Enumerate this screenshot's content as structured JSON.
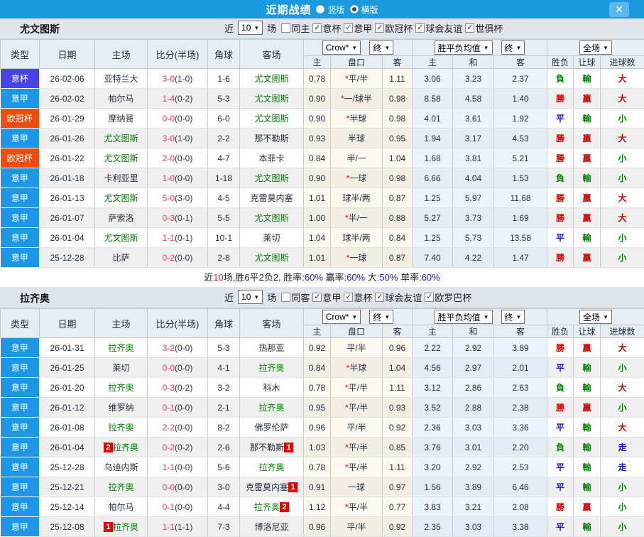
{
  "titlebar": {
    "title": "近期战绩",
    "radios": [
      {
        "label": "竖版",
        "selected": false
      },
      {
        "label": "横版",
        "selected": true
      }
    ],
    "close_label": "✕"
  },
  "colors": {
    "topbar": "#1b99de",
    "team_green": "#008000",
    "score_red": "#f53d55",
    "type_badges": {
      "意杯": "#4a42e4",
      "意甲": "#1d96e8",
      "欧冠杯": "#f04a0e"
    }
  },
  "table_header": {
    "cols": [
      "类型",
      "日期",
      "主场",
      "比分(半场)",
      "角球",
      "客场"
    ],
    "subcols": [
      "主",
      "盘口",
      "客",
      "主",
      "和",
      "客",
      "胜负",
      "让球",
      "进球数"
    ],
    "dropdowns": {
      "crow": "Crow*",
      "end1": "终",
      "avg": "胜平负均值",
      "end2": "终",
      "full": "全场"
    }
  },
  "sections": [
    {
      "team": "尤文图斯",
      "filter": {
        "prefix": "近",
        "count": "10",
        "suffix": "场",
        "checkboxes": [
          {
            "label": "同主",
            "checked": false
          },
          {
            "label": "意杯",
            "checked": true
          },
          {
            "label": "意甲",
            "checked": true
          },
          {
            "label": "欧冠杯",
            "checked": true
          },
          {
            "label": "球会友谊",
            "checked": true
          },
          {
            "label": "世俱杯",
            "checked": true
          }
        ]
      },
      "rows": [
        {
          "type": "意杯",
          "date": "26-02-06",
          "home": "亚特兰大",
          "home_focal": false,
          "home_card": "",
          "ft": "3-0",
          "ht": "(1-0)",
          "corner": "1-6",
          "away": "尤文图斯",
          "away_focal": true,
          "away_card": "",
          "ah_home": "0.78",
          "ah_line": "*平/半",
          "ah_away": "1.11",
          "o_home": "3.06",
          "o_draw": "3.23",
          "o_away": "2.37",
          "r_wdl": "負",
          "r_ah": "輸",
          "r_ou": "大"
        },
        {
          "type": "意甲",
          "date": "26-02-02",
          "home": "帕尔马",
          "home_focal": false,
          "home_card": "",
          "ft": "1-4",
          "ht": "(0-2)",
          "corner": "5-3",
          "away": "尤文图斯",
          "away_focal": true,
          "away_card": "",
          "ah_home": "0.90",
          "ah_line": "*一/球半",
          "ah_away": "0.98",
          "o_home": "8.58",
          "o_draw": "4.58",
          "o_away": "1.40",
          "r_wdl": "勝",
          "r_ah": "贏",
          "r_ou": "大"
        },
        {
          "type": "欧冠杯",
          "date": "26-01-29",
          "home": "摩纳哥",
          "home_focal": false,
          "home_card": "",
          "ft": "0-0",
          "ht": "(0-0)",
          "corner": "6-0",
          "away": "尤文图斯",
          "away_focal": true,
          "away_card": "",
          "ah_home": "0.90",
          "ah_line": "*半球",
          "ah_away": "0.98",
          "o_home": "4.01",
          "o_draw": "3.61",
          "o_away": "1.92",
          "r_wdl": "平",
          "r_ah": "輸",
          "r_ou": "小"
        },
        {
          "type": "意甲",
          "date": "26-01-26",
          "home": "尤文图斯",
          "home_focal": true,
          "home_card": "",
          "ft": "3-0",
          "ht": "(1-0)",
          "corner": "2-2",
          "away": "那不勒斯",
          "away_focal": false,
          "away_card": "",
          "ah_home": "0.93",
          "ah_line": "半球",
          "ah_away": "0.95",
          "o_home": "1.94",
          "o_draw": "3.17",
          "o_away": "4.53",
          "r_wdl": "勝",
          "r_ah": "贏",
          "r_ou": "大"
        },
        {
          "type": "欧冠杯",
          "date": "26-01-22",
          "home": "尤文图斯",
          "home_focal": true,
          "home_card": "",
          "ft": "2-0",
          "ht": "(0-0)",
          "corner": "4-7",
          "away": "本菲卡",
          "away_focal": false,
          "away_card": "",
          "ah_home": "0.84",
          "ah_line": "半/一",
          "ah_away": "1.04",
          "o_home": "1.68",
          "o_draw": "3.81",
          "o_away": "5.21",
          "r_wdl": "勝",
          "r_ah": "贏",
          "r_ou": "小"
        },
        {
          "type": "意甲",
          "date": "26-01-18",
          "home": "卡利亚里",
          "home_focal": false,
          "home_card": "",
          "ft": "1-0",
          "ht": "(0-0)",
          "corner": "1-18",
          "away": "尤文图斯",
          "away_focal": true,
          "away_card": "",
          "ah_home": "0.90",
          "ah_line": "*一球",
          "ah_away": "0.98",
          "o_home": "6.66",
          "o_draw": "4.04",
          "o_away": "1.53",
          "r_wdl": "負",
          "r_ah": "輸",
          "r_ou": "小"
        },
        {
          "type": "意甲",
          "date": "26-01-13",
          "home": "尤文图斯",
          "home_focal": true,
          "home_card": "",
          "ft": "5-0",
          "ht": "(3-0)",
          "corner": "4-5",
          "away": "克雷莫内塞",
          "away_focal": false,
          "away_card": "",
          "ah_home": "1.01",
          "ah_line": "球半/两",
          "ah_away": "0.87",
          "o_home": "1.25",
          "o_draw": "5.97",
          "o_away": "11.68",
          "r_wdl": "勝",
          "r_ah": "贏",
          "r_ou": "大"
        },
        {
          "type": "意甲",
          "date": "26-01-07",
          "home": "萨索洛",
          "home_focal": false,
          "home_card": "",
          "ft": "0-3",
          "ht": "(0-1)",
          "corner": "5-5",
          "away": "尤文图斯",
          "away_focal": true,
          "away_card": "",
          "ah_home": "1.00",
          "ah_line": "*半/一",
          "ah_away": "0.88",
          "o_home": "5.27",
          "o_draw": "3.73",
          "o_away": "1.69",
          "r_wdl": "勝",
          "r_ah": "贏",
          "r_ou": "大"
        },
        {
          "type": "意甲",
          "date": "26-01-04",
          "home": "尤文图斯",
          "home_focal": true,
          "home_card": "",
          "ft": "1-1",
          "ht": "(0-1)",
          "corner": "10-1",
          "away": "莱切",
          "away_focal": false,
          "away_card": "",
          "ah_home": "1.04",
          "ah_line": "球半/两",
          "ah_away": "0.84",
          "o_home": "1.25",
          "o_draw": "5.73",
          "o_away": "13.58",
          "r_wdl": "平",
          "r_ah": "輸",
          "r_ou": "小"
        },
        {
          "type": "意甲",
          "date": "25-12-28",
          "home": "比萨",
          "home_focal": false,
          "home_card": "",
          "ft": "0-2",
          "ht": "(0-0)",
          "corner": "2-8",
          "away": "尤文图斯",
          "away_focal": true,
          "away_card": "",
          "ah_home": "1.01",
          "ah_line": "*一球",
          "ah_away": "0.87",
          "o_home": "7.40",
          "o_draw": "4.22",
          "o_away": "1.47",
          "r_wdl": "勝",
          "r_ah": "贏",
          "r_ou": "小"
        }
      ],
      "summary": [
        [
          "近",
          "k"
        ],
        [
          "10",
          "r"
        ],
        [
          "场,胜6平2负2, 胜率:",
          "k"
        ],
        [
          "60%",
          "b"
        ],
        [
          " 赢率:",
          "k"
        ],
        [
          "60%",
          "b"
        ],
        [
          " 大:",
          "k"
        ],
        [
          "50%",
          "b"
        ],
        [
          " 单率:",
          "k"
        ],
        [
          "60%",
          "b"
        ]
      ]
    },
    {
      "team": "拉齐奥",
      "filter": {
        "prefix": "近",
        "count": "10",
        "suffix": "场",
        "checkboxes": [
          {
            "label": "同客",
            "checked": false
          },
          {
            "label": "意甲",
            "checked": true
          },
          {
            "label": "意杯",
            "checked": true
          },
          {
            "label": "球会友谊",
            "checked": true
          },
          {
            "label": "欧罗巴杯",
            "checked": true
          }
        ]
      },
      "rows": [
        {
          "type": "意甲",
          "date": "26-01-31",
          "home": "拉齐奥",
          "home_focal": true,
          "home_card": "",
          "ft": "3-2",
          "ht": "(0-0)",
          "corner": "5-3",
          "away": "热那亚",
          "away_focal": false,
          "away_card": "",
          "ah_home": "0.92",
          "ah_line": "平/半",
          "ah_away": "0.96",
          "o_home": "2.22",
          "o_draw": "2.92",
          "o_away": "3.89",
          "r_wdl": "勝",
          "r_ah": "贏",
          "r_ou": "大"
        },
        {
          "type": "意甲",
          "date": "26-01-25",
          "home": "莱切",
          "home_focal": false,
          "home_card": "",
          "ft": "0-0",
          "ht": "(0-0)",
          "corner": "4-1",
          "away": "拉齐奥",
          "away_focal": true,
          "away_card": "",
          "ah_home": "0.84",
          "ah_line": "*半球",
          "ah_away": "1.04",
          "o_home": "4.56",
          "o_draw": "2.97",
          "o_away": "2.01",
          "r_wdl": "平",
          "r_ah": "輸",
          "r_ou": "小"
        },
        {
          "type": "意甲",
          "date": "26-01-20",
          "home": "拉齐奥",
          "home_focal": true,
          "home_card": "",
          "ft": "0-3",
          "ht": "(0-2)",
          "corner": "3-2",
          "away": "科木",
          "away_focal": false,
          "away_card": "",
          "ah_home": "0.78",
          "ah_line": "*平/半",
          "ah_away": "1.11",
          "o_home": "3.12",
          "o_draw": "2.86",
          "o_away": "2.63",
          "r_wdl": "負",
          "r_ah": "輸",
          "r_ou": "大"
        },
        {
          "type": "意甲",
          "date": "26-01-12",
          "home": "维罗纳",
          "home_focal": false,
          "home_card": "",
          "ft": "0-1",
          "ht": "(0-0)",
          "corner": "2-1",
          "away": "拉齐奥",
          "away_focal": true,
          "away_card": "",
          "ah_home": "0.95",
          "ah_line": "*平/半",
          "ah_away": "0.93",
          "o_home": "3.52",
          "o_draw": "2.88",
          "o_away": "2.38",
          "r_wdl": "勝",
          "r_ah": "贏",
          "r_ou": "小"
        },
        {
          "type": "意甲",
          "date": "26-01-08",
          "home": "拉齐奥",
          "home_focal": true,
          "home_card": "",
          "ft": "2-2",
          "ht": "(0-0)",
          "corner": "8-2",
          "away": "佛罗伦萨",
          "away_focal": false,
          "away_card": "",
          "ah_home": "0.96",
          "ah_line": "平/半",
          "ah_away": "0.92",
          "o_home": "2.36",
          "o_draw": "3.03",
          "o_away": "3.36",
          "r_wdl": "平",
          "r_ah": "輸",
          "r_ou": "大"
        },
        {
          "type": "意甲",
          "date": "26-01-04",
          "home": "拉齐奥",
          "home_focal": true,
          "home_card": "2",
          "ft": "0-2",
          "ht": "(0-2)",
          "corner": "2-6",
          "away": "那不勒斯",
          "away_focal": false,
          "away_card": "1",
          "ah_home": "1.03",
          "ah_line": "*平/半",
          "ah_away": "0.85",
          "o_home": "3.76",
          "o_draw": "3.01",
          "o_away": "2.20",
          "r_wdl": "負",
          "r_ah": "輸",
          "r_ou": "走"
        },
        {
          "type": "意甲",
          "date": "25-12-28",
          "home": "乌迪内斯",
          "home_focal": false,
          "home_card": "",
          "ft": "1-1",
          "ht": "(0-0)",
          "corner": "5-6",
          "away": "拉齐奥",
          "away_focal": true,
          "away_card": "",
          "ah_home": "0.78",
          "ah_line": "*平/半",
          "ah_away": "1.11",
          "o_home": "3.20",
          "o_draw": "2.92",
          "o_away": "2.53",
          "r_wdl": "平",
          "r_ah": "輸",
          "r_ou": "走"
        },
        {
          "type": "意甲",
          "date": "25-12-21",
          "home": "拉齐奥",
          "home_focal": true,
          "home_card": "",
          "ft": "0-0",
          "ht": "(0-0)",
          "corner": "3-0",
          "away": "克雷莫内塞",
          "away_focal": false,
          "away_card": "1",
          "ah_home": "0.91",
          "ah_line": "一球",
          "ah_away": "0.97",
          "o_home": "1.56",
          "o_draw": "3.89",
          "o_away": "6.46",
          "r_wdl": "平",
          "r_ah": "輸",
          "r_ou": "小"
        },
        {
          "type": "意甲",
          "date": "25-12-14",
          "home": "帕尔马",
          "home_focal": false,
          "home_card": "",
          "ft": "0-1",
          "ht": "(0-0)",
          "corner": "4-4",
          "away": "拉齐奥",
          "away_focal": true,
          "away_card": "2",
          "ah_home": "1.12",
          "ah_line": "*平/半",
          "ah_away": "0.77",
          "o_home": "3.83",
          "o_draw": "3.21",
          "o_away": "2.08",
          "r_wdl": "勝",
          "r_ah": "贏",
          "r_ou": "小"
        },
        {
          "type": "意甲",
          "date": "25-12-08",
          "home": "拉齐奥",
          "home_focal": true,
          "home_card": "1",
          "ft": "1-1",
          "ht": "(1-1)",
          "corner": "7-3",
          "away": "博洛尼亚",
          "away_focal": false,
          "away_card": "",
          "ah_home": "0.96",
          "ah_line": "平/半",
          "ah_away": "0.92",
          "o_home": "2.35",
          "o_draw": "3.03",
          "o_away": "3.38",
          "r_wdl": "平",
          "r_ah": "輸",
          "r_ou": "小"
        }
      ],
      "summary": null
    }
  ]
}
